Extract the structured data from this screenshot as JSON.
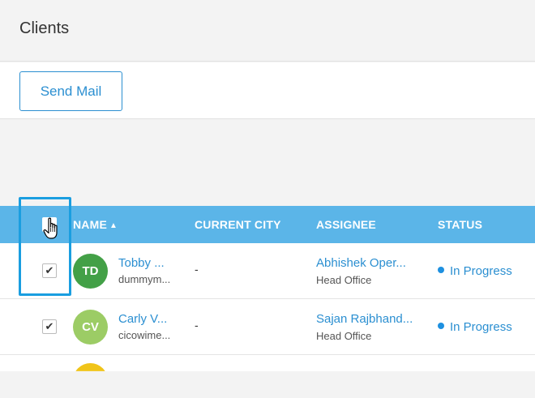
{
  "page": {
    "title": "Clients"
  },
  "toolbar": {
    "send_mail_label": "Send Mail"
  },
  "table": {
    "columns": {
      "name": "NAME",
      "current_city": "CURRENT CITY",
      "assignee": "ASSIGNEE",
      "status": "STATUS"
    },
    "select_all_checked": true,
    "rows": [
      {
        "checked": "✔",
        "initials": "TD",
        "avatar_color": "#43a047",
        "name": "Tobby ...",
        "email": "dummym...",
        "city": "-",
        "assignee": "Abhishek Oper...",
        "office": "Head Office",
        "status": "In Progress"
      },
      {
        "checked": "✔",
        "initials": "CV",
        "avatar_color": "#9ccc65",
        "name": "Carly V...",
        "email": "cicowime...",
        "city": "-",
        "assignee": "Sajan Rajbhand...",
        "office": "Head Office",
        "status": "In Progress"
      }
    ]
  },
  "colors": {
    "accent": "#2b8fd1",
    "header_bar": "#5bb5e8",
    "highlight": "#1a9ee0",
    "status_dot": "#1e90e0"
  }
}
